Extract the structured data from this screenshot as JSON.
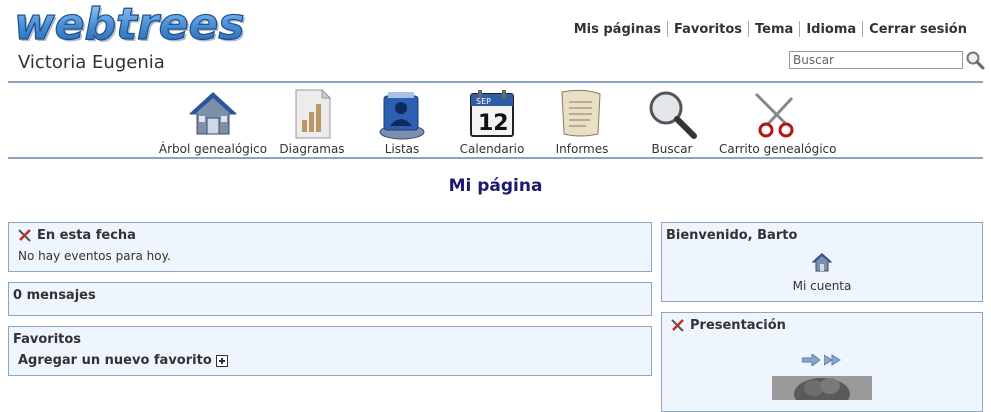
{
  "header": {
    "logo_text": "webtrees",
    "tree_name": "Victoria Eugenia",
    "menu": [
      "Mis páginas",
      "Favoritos",
      "Tema",
      "Idioma",
      "Cerrar sesión"
    ],
    "search": {
      "placeholder": "Buscar",
      "icon": "magnifier-icon"
    }
  },
  "main_menu": [
    {
      "label": "Árbol genealógico",
      "icon": "house-icon"
    },
    {
      "label": "Diagramas",
      "icon": "chart-document-icon"
    },
    {
      "label": "Listas",
      "icon": "people-list-icon"
    },
    {
      "label": "Calendario",
      "icon": "calendar-icon",
      "calendar_month": "SEP",
      "calendar_day": "12"
    },
    {
      "label": "Informes",
      "icon": "scroll-icon"
    },
    {
      "label": "Buscar",
      "icon": "magnifying-glass-icon"
    },
    {
      "label": "Carrito genealógico",
      "icon": "scissors-icon"
    }
  ],
  "page_title": "Mi página",
  "blocks": {
    "on_this_day": {
      "title": "En esta fecha",
      "content": "No hay eventos para hoy."
    },
    "messages": {
      "title": "0 mensajes"
    },
    "favorites": {
      "title": "Favoritos",
      "add_label": "Agregar un nuevo favorito"
    },
    "welcome": {
      "title": "Bienvenido, Barto",
      "account_label": "Mi cuenta"
    },
    "slideshow": {
      "title": "Presentación"
    }
  },
  "colors": {
    "accent_rule": "#8aa4c0",
    "block_bg": "#eef5fc",
    "block_border": "#8ba6c1",
    "title_color": "#1a1a6e",
    "logo_blue": "#4a8fd8"
  }
}
